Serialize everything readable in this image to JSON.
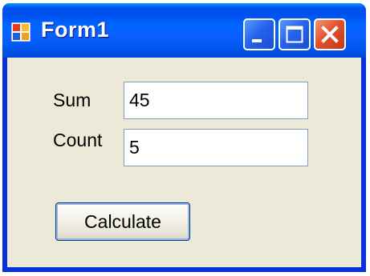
{
  "window": {
    "title": "Form1",
    "icon": "windows-form-icon",
    "controls": {
      "minimize_icon": "minimize-icon",
      "maximize_icon": "maximize-icon",
      "close_icon": "close-icon"
    }
  },
  "form": {
    "sum_label": "Sum",
    "sum_value": "45",
    "count_label": "Count",
    "count_value": "5",
    "calculate_label": "Calculate"
  },
  "colors": {
    "titlebar_blue": "#0058ee",
    "close_red": "#e2512c",
    "client_background": "#ece9d8",
    "textbox_border": "#7f9db9"
  }
}
